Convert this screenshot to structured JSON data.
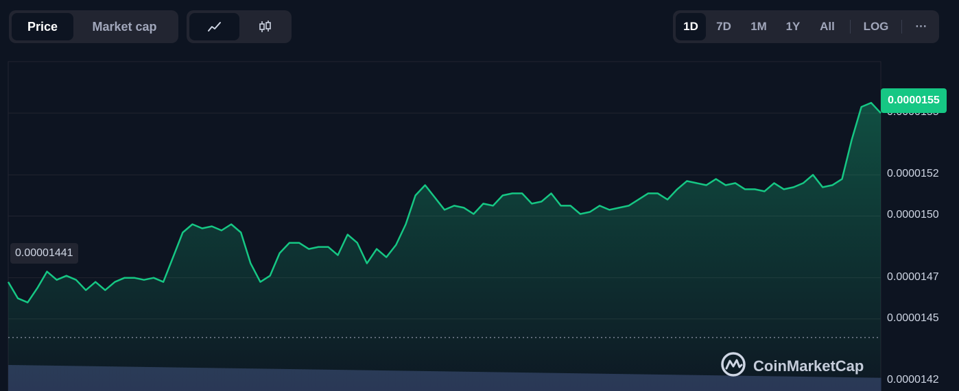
{
  "toolbar": {
    "type_tabs": [
      "Price",
      "Market cap"
    ],
    "active_type": "Price",
    "chart_style": {
      "line_icon": "line-chart-icon",
      "candle_icon": "candlestick-icon",
      "active": "line"
    },
    "ranges": [
      "1D",
      "7D",
      "1M",
      "1Y",
      "All"
    ],
    "active_range": "1D",
    "log_label": "LOG",
    "more_label": "···"
  },
  "labels": {
    "last_price": "0.0000155",
    "start_price": "0.00001441"
  },
  "watermark": {
    "text": "CoinMarketCap",
    "icon": "coinmarketcap-logo-icon"
  },
  "colors": {
    "line": "#16c784",
    "background": "#0d1421",
    "volume": "#2b3555",
    "grid": "#222531"
  },
  "chart_data": {
    "type": "area",
    "title": "",
    "xlabel": "",
    "ylabel": "",
    "ylim": [
      1.415e-05,
      1.575e-05
    ],
    "y_ticks": [
      "0.0000142",
      "0.0000145",
      "0.0000147",
      "0.0000150",
      "0.0000152",
      "0.0000155"
    ],
    "y_tick_values": [
      1.42e-05,
      1.45e-05,
      1.47e-05,
      1.5e-05,
      1.52e-05,
      1.55e-05
    ],
    "baseline": 1.441e-05,
    "last_value": 1.55e-05,
    "grid": true,
    "series": [
      {
        "values": [
          1.468e-05,
          1.46e-05,
          1.458e-05,
          1.465e-05,
          1.473e-05,
          1.469e-05,
          1.471e-05,
          1.469e-05,
          1.464e-05,
          1.468e-05,
          1.464e-05,
          1.468e-05,
          1.47e-05,
          1.47e-05,
          1.469e-05,
          1.47e-05,
          1.468e-05,
          1.48e-05,
          1.492e-05,
          1.496e-05,
          1.494e-05,
          1.495e-05,
          1.493e-05,
          1.496e-05,
          1.492e-05,
          1.477e-05,
          1.468e-05,
          1.471e-05,
          1.482e-05,
          1.487e-05,
          1.487e-05,
          1.484e-05,
          1.485e-05,
          1.485e-05,
          1.481e-05,
          1.491e-05,
          1.487e-05,
          1.477e-05,
          1.484e-05,
          1.48e-05,
          1.486e-05,
          1.496e-05,
          1.51e-05,
          1.515e-05,
          1.509e-05,
          1.503e-05,
          1.505e-05,
          1.504e-05,
          1.501e-05,
          1.506e-05,
          1.505e-05,
          1.51e-05,
          1.511e-05,
          1.511e-05,
          1.506e-05,
          1.507e-05,
          1.511e-05,
          1.505e-05,
          1.505e-05,
          1.501e-05,
          1.502e-05,
          1.505e-05,
          1.503e-05,
          1.504e-05,
          1.505e-05,
          1.508e-05,
          1.511e-05,
          1.511e-05,
          1.508e-05,
          1.513e-05,
          1.517e-05,
          1.516e-05,
          1.515e-05,
          1.518e-05,
          1.515e-05,
          1.516e-05,
          1.513e-05,
          1.513e-05,
          1.512e-05,
          1.516e-05,
          1.513e-05,
          1.514e-05,
          1.516e-05,
          1.52e-05,
          1.514e-05,
          1.515e-05,
          1.518e-05,
          1.537e-05,
          1.553e-05,
          1.555e-05,
          1.55e-05
        ]
      }
    ],
    "volume": {
      "note": "relative volume bars, decreasing left to right",
      "start": 1.0,
      "end": 0.45
    }
  }
}
